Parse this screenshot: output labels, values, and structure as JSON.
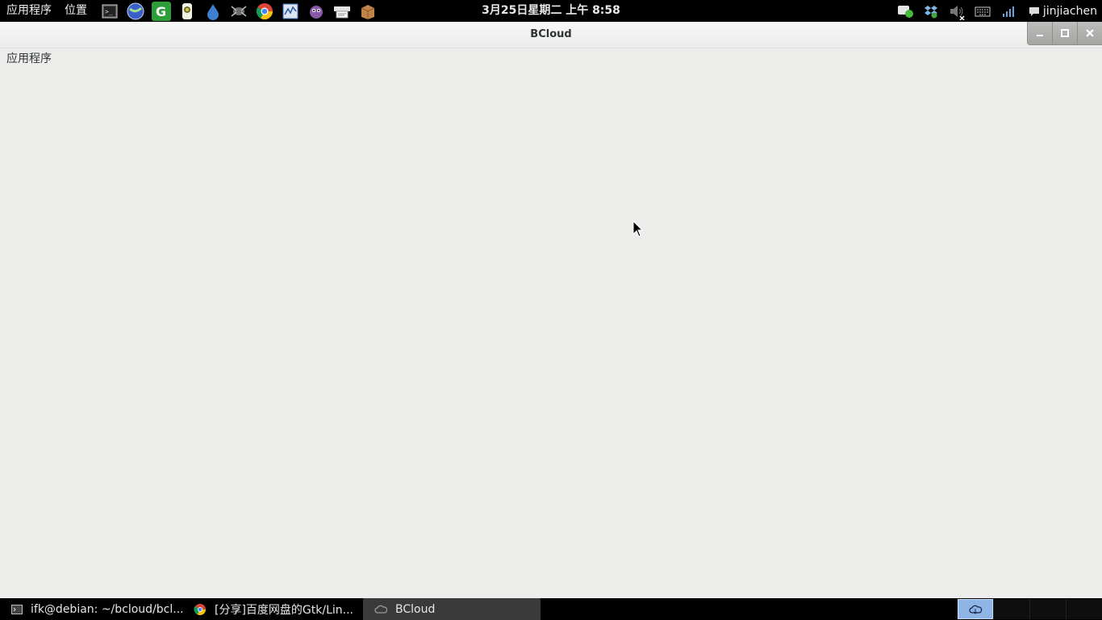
{
  "top_panel": {
    "applications_menu": "应用程序",
    "places_menu": "位置",
    "launchers": [
      {
        "name": "terminal-launcher",
        "icon": "terminal-icon"
      },
      {
        "name": "browser-launcher",
        "icon": "globe-icon"
      },
      {
        "name": "green-app-launcher",
        "icon": "green-g-icon"
      },
      {
        "name": "usb-app-launcher",
        "icon": "usb-device-icon"
      },
      {
        "name": "drop-app-launcher",
        "icon": "droplet-icon"
      },
      {
        "name": "dark-app-launcher",
        "icon": "spider-icon"
      },
      {
        "name": "chrome-launcher",
        "icon": "chrome-icon"
      },
      {
        "name": "monitor-launcher",
        "icon": "system-monitor-icon"
      },
      {
        "name": "pidgin-launcher",
        "icon": "pidgin-icon"
      },
      {
        "name": "scanner-launcher",
        "icon": "scanner-icon"
      },
      {
        "name": "package-launcher",
        "icon": "package-box-icon"
      }
    ],
    "clock": "3月25日星期二 上午  8:58",
    "tray": {
      "icons": [
        "chat-status-icon",
        "dropbox-icon",
        "volume-muted-icon",
        "keyboard-icon",
        "network-signal-icon"
      ],
      "user": "jinjiachen"
    }
  },
  "window": {
    "title": "BCloud",
    "content_label": "应用程序",
    "controls": [
      "minimize",
      "maximize",
      "close"
    ]
  },
  "taskbar": {
    "tasks": [
      {
        "label": "ifk@debian: ~/bcloud/bcl...",
        "icon": "terminal-icon",
        "active": false
      },
      {
        "label": "[分享]百度网盘的Gtk/Lin...",
        "icon": "chrome-icon",
        "active": false
      },
      {
        "label": "BCloud",
        "icon": "cloud-icon",
        "active": true
      }
    ],
    "workspaces": 4,
    "active_workspace": 1
  },
  "colors": {
    "panel_bg": "#000000",
    "window_bg": "#ededec",
    "workspace_active": "#8fb4e6"
  }
}
